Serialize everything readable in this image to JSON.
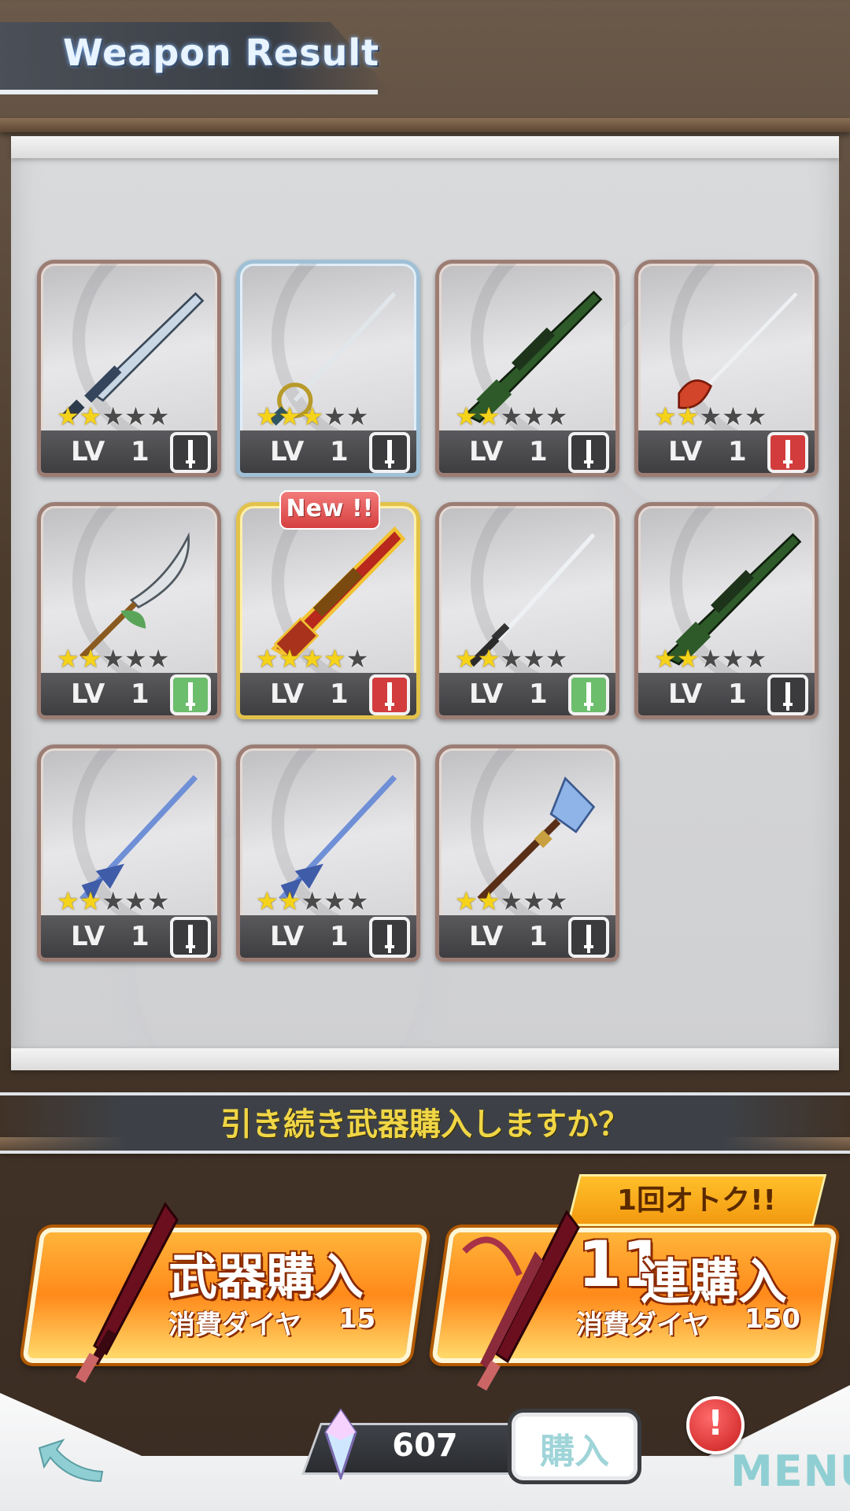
{
  "header": {
    "title": "Weapon Result"
  },
  "weapons": [
    {
      "stars": 2,
      "level_label": "LV",
      "level": "1",
      "type_color": "dark",
      "frame": "bronze",
      "kind": "broadsword"
    },
    {
      "stars": 3,
      "level_label": "LV",
      "level": "1",
      "type_color": "dark",
      "frame": "silver",
      "kind": "rapier"
    },
    {
      "stars": 2,
      "level_label": "LV",
      "level": "1",
      "type_color": "dark",
      "frame": "bronze",
      "kind": "sniper-rifle"
    },
    {
      "stars": 2,
      "level_label": "LV",
      "level": "1",
      "type_color": "red",
      "frame": "bronze",
      "kind": "rapier-red"
    },
    {
      "stars": 2,
      "level_label": "LV",
      "level": "1",
      "type_color": "green",
      "frame": "bronze",
      "kind": "glaive"
    },
    {
      "stars": 4,
      "level_label": "LV",
      "level": "1",
      "type_color": "red",
      "frame": "gold",
      "kind": "gold-rifle",
      "badge": "New !!"
    },
    {
      "stars": 2,
      "level_label": "LV",
      "level": "1",
      "type_color": "green",
      "frame": "bronze",
      "kind": "katana"
    },
    {
      "stars": 2,
      "level_label": "LV",
      "level": "1",
      "type_color": "dark",
      "frame": "bronze",
      "kind": "sniper-rifle"
    },
    {
      "stars": 2,
      "level_label": "LV",
      "level": "1",
      "type_color": "dark",
      "frame": "bronze",
      "kind": "blue-lance"
    },
    {
      "stars": 2,
      "level_label": "LV",
      "level": "1",
      "type_color": "dark",
      "frame": "bronze",
      "kind": "blue-lance"
    },
    {
      "stars": 2,
      "level_label": "LV",
      "level": "1",
      "type_color": "dark",
      "frame": "bronze",
      "kind": "mace"
    }
  ],
  "prompt": {
    "text": "引き続き武器購入しますか？"
  },
  "buy_single": {
    "title": "武器購入",
    "cost_label": "消費ダイヤ",
    "cost": "15"
  },
  "buy_multi": {
    "deal_label": "1回オトク!!",
    "title_num": "11",
    "title": "連購入",
    "cost_label": "消費ダイヤ",
    "cost": "150"
  },
  "footer": {
    "diamonds": "607",
    "purchase_label": "購入",
    "alert": "!",
    "menu_label": "MENU"
  },
  "colors": {
    "accent": "#ff8a1a",
    "new_badge": "#d64040",
    "type_red": "#d23c3c",
    "type_green": "#6cbd6c",
    "star_on": "#f5d31a"
  }
}
